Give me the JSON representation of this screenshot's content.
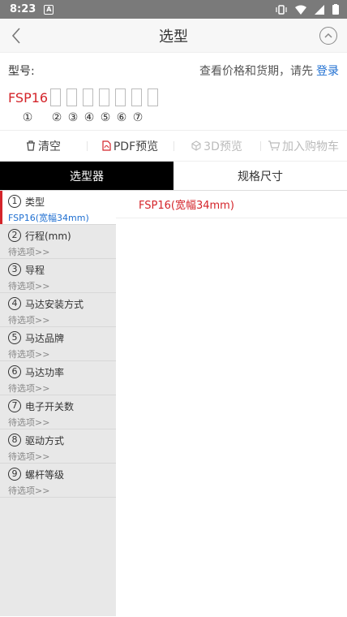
{
  "status_bar": {
    "time": "8:23",
    "notification_icon": "A"
  },
  "header": {
    "title": "选型"
  },
  "model": {
    "label": "型号:",
    "hint": "查看价格和货期，请先",
    "login": "登录",
    "prefix": "FSP16",
    "numbers": [
      "①",
      "②",
      "③",
      "④",
      "⑤",
      "⑥",
      "⑦"
    ]
  },
  "toolbar": {
    "clear": "清空",
    "pdf": "PDF预览",
    "preview3d": "3D预览",
    "cart": "加入购物车"
  },
  "tabs": {
    "selector": "选型器",
    "spec": "规格尺寸"
  },
  "steps": [
    {
      "num": "1",
      "title": "类型",
      "value": "FSP16(宽幅34mm)"
    },
    {
      "num": "2",
      "title": "行程(mm)",
      "value": "待选项>>"
    },
    {
      "num": "3",
      "title": "导程",
      "value": "待选项>>"
    },
    {
      "num": "4",
      "title": "马达安装方式",
      "value": "待选项>>"
    },
    {
      "num": "5",
      "title": "马达品牌",
      "value": "待选项>>"
    },
    {
      "num": "6",
      "title": "马达功率",
      "value": "待选项>>"
    },
    {
      "num": "7",
      "title": "电子开关数",
      "value": "待选项>>"
    },
    {
      "num": "8",
      "title": "驱动方式",
      "value": "待选项>>"
    },
    {
      "num": "9",
      "title": "螺杆等级",
      "value": "待选项>>"
    }
  ],
  "options": [
    "FSP16(宽幅34mm)"
  ],
  "colors": {
    "accent_red": "#d4242a",
    "link_blue": "#1f6fd1",
    "tab_active": "#000000"
  }
}
